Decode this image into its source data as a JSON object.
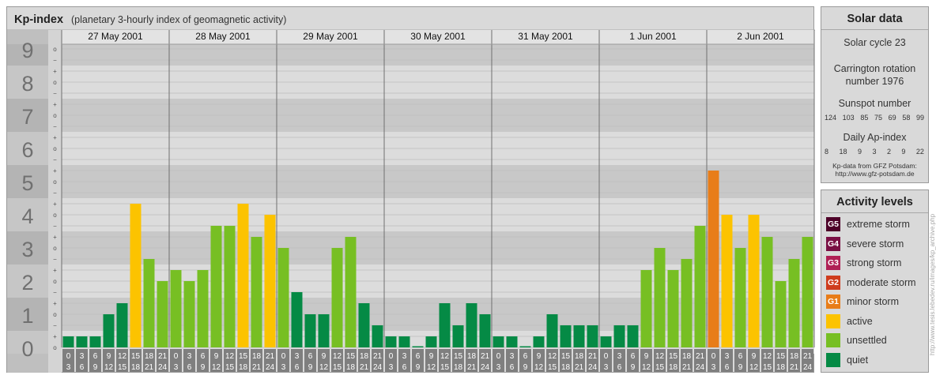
{
  "header": {
    "title": "Kp-index",
    "subtitle": "(planetary 3-hourly index of geomagnetic activity)"
  },
  "chart_data": {
    "type": "bar",
    "ylim": [
      0,
      9
    ],
    "y_ticks": [
      "0",
      "1",
      "2",
      "3",
      "4",
      "5",
      "6",
      "7",
      "8",
      "9"
    ],
    "sub_ticks": [
      "+",
      "o",
      "−"
    ],
    "day_labels": [
      "27 May 2001",
      "28 May 2001",
      "29 May 2001",
      "30 May 2001",
      "31 May 2001",
      "1 Jun 2001",
      "2 Jun 2001"
    ],
    "interval_labels": [
      [
        "0",
        "3"
      ],
      [
        "3",
        "6"
      ],
      [
        "6",
        "9"
      ],
      [
        "9",
        "12"
      ],
      [
        "12",
        "15"
      ],
      [
        "15",
        "18"
      ],
      [
        "18",
        "21"
      ],
      [
        "21",
        "24"
      ]
    ],
    "values": [
      [
        0.333,
        0.333,
        0.333,
        1.0,
        1.333,
        4.333,
        2.667,
        2.0
      ],
      [
        2.333,
        2.0,
        2.333,
        3.667,
        3.667,
        4.333,
        3.333,
        4.0
      ],
      [
        3.0,
        1.667,
        1.0,
        1.0,
        3.0,
        3.333,
        1.333,
        0.667
      ],
      [
        0.333,
        0.333,
        0.0,
        0.333,
        1.333,
        0.667,
        1.333,
        1.0
      ],
      [
        0.333,
        0.333,
        0.0,
        0.333,
        1.0,
        0.667,
        0.667,
        0.667
      ],
      [
        0.333,
        0.667,
        0.667,
        2.333,
        3.0,
        2.333,
        2.667,
        3.667
      ],
      [
        5.333,
        4.0,
        3.0,
        4.0,
        3.333,
        2.0,
        2.667,
        3.333
      ]
    ],
    "colors": {
      "quiet": "#058a45",
      "unsettled": "#77bf23",
      "active": "#fcc300",
      "minor_storm": "#e87d19",
      "moderate_storm": "#cf3c1d",
      "strong_storm": "#b02055",
      "severe_storm": "#7a1044",
      "extreme_storm": "#4d0028"
    }
  },
  "solar": {
    "title": "Solar data",
    "cycle": "Solar cycle 23",
    "carrington_line1": "Carrington rotation",
    "carrington_line2": "number 1976",
    "sunspot_title": "Sunspot number",
    "sunspot_values": [
      "124",
      "103",
      "85",
      "75",
      "69",
      "58",
      "99"
    ],
    "ap_title": "Daily Ap-index",
    "ap_values": [
      "8",
      "18",
      "9",
      "3",
      "2",
      "9",
      "22"
    ],
    "credit_line1": "Kp-data from GFZ Potsdam:",
    "credit_line2": "http://www.gfz-potsdam.de"
  },
  "activity": {
    "title": "Activity levels",
    "levels": [
      {
        "code": "G5",
        "label": "extreme storm",
        "color": "#4d0028"
      },
      {
        "code": "G4",
        "label": "severe storm",
        "color": "#7a1044"
      },
      {
        "code": "G3",
        "label": "strong storm",
        "color": "#b02055"
      },
      {
        "code": "G2",
        "label": "moderate storm",
        "color": "#cf3c1d"
      },
      {
        "code": "G1",
        "label": "minor storm",
        "color": "#e87d19"
      },
      {
        "code": "",
        "label": "active",
        "color": "#fcc300"
      },
      {
        "code": "",
        "label": "unsettled",
        "color": "#77bf23"
      },
      {
        "code": "",
        "label": "quiet",
        "color": "#058a45"
      }
    ]
  },
  "watermark": "http://www.tesis.lebedev.ru/images/kp_archive.php"
}
